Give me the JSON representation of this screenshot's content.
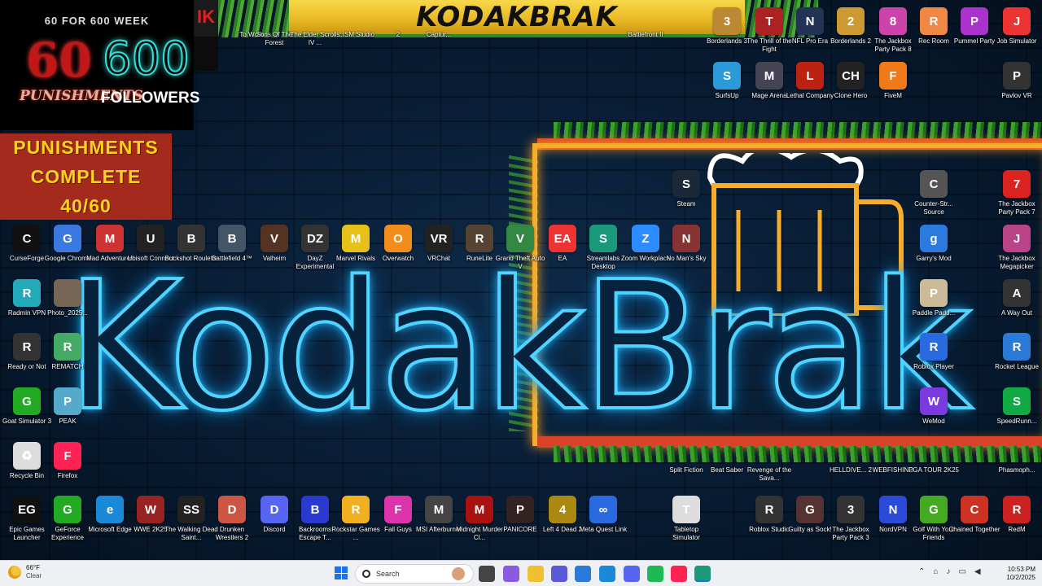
{
  "overlay": {
    "week_label": "60 FOR 600 WEEK",
    "num_a": "60",
    "num_b": "600",
    "label_a": "PUNISHMENTS",
    "label_b": "FOLLOWERS",
    "complete_line1": "PUNISHMENTS",
    "complete_line2": "COMPLETE",
    "complete_progress": "40/60",
    "strip_text": "IK"
  },
  "banner": {
    "title": "KODAKBRAK"
  },
  "wallpaper": {
    "neon_text": "KodakBrak"
  },
  "icons": [
    {
      "label": "To Work",
      "color": "#223",
      "glyph": ""
    },
    {
      "label": "Sons Of The Forest",
      "color": "#2a3a2a",
      "glyph": ""
    },
    {
      "label": "The Elder Scrolls IV ...",
      "color": "#3a3020",
      "glyph": ""
    },
    {
      "label": "...ISM Studio",
      "color": "#333",
      "glyph": ""
    },
    {
      "label": "2",
      "color": "#333",
      "glyph": ""
    },
    {
      "label": "Captur...",
      "color": "#333",
      "glyph": ""
    },
    {
      "label": "Battlefront II",
      "color": "#333",
      "glyph": ""
    },
    {
      "label": "Borderlands 3",
      "color": "#b83",
      "glyph": "3"
    },
    {
      "label": "The Thrill of the Fight",
      "color": "#a22",
      "glyph": "T"
    },
    {
      "label": "NFL Pro Era",
      "color": "#235",
      "glyph": "N"
    },
    {
      "label": "Borderlands 2",
      "color": "#c93",
      "glyph": "2"
    },
    {
      "label": "The Jackbox Party Pack 8",
      "color": "#c4a",
      "glyph": "8"
    },
    {
      "label": "Rec Room",
      "color": "#e84",
      "glyph": "R"
    },
    {
      "label": "Pummel Party",
      "color": "#a3c",
      "glyph": "P"
    },
    {
      "label": "Job Simulator",
      "color": "#e33",
      "glyph": "J"
    },
    {
      "label": "SurfsUp",
      "color": "#2a9ad8",
      "glyph": "S"
    },
    {
      "label": "Mage Arena",
      "color": "#445",
      "glyph": "M"
    },
    {
      "label": "Lethal Company",
      "color": "#b21",
      "glyph": "L"
    },
    {
      "label": "Clone Hero",
      "color": "#222",
      "glyph": "CH"
    },
    {
      "label": "FiveM",
      "color": "#f07a1a",
      "glyph": "F"
    },
    {
      "label": "Pavlov VR",
      "color": "#333",
      "glyph": "P"
    },
    {
      "label": "Steam",
      "color": "#1b2838",
      "glyph": "S"
    },
    {
      "label": "Counter-Str... Source",
      "color": "#555",
      "glyph": "C"
    },
    {
      "label": "The Jackbox Party Pack 7",
      "color": "#d22",
      "glyph": "7"
    },
    {
      "label": "CurseForge",
      "color": "#111",
      "glyph": "C"
    },
    {
      "label": "Google Chrome",
      "color": "#3a7ae0",
      "glyph": "G"
    },
    {
      "label": "Mad Adventures",
      "color": "#c33",
      "glyph": "M"
    },
    {
      "label": "Ubisoft Connect",
      "color": "#222",
      "glyph": "U"
    },
    {
      "label": "Buckshot Roulette",
      "color": "#333",
      "glyph": "B"
    },
    {
      "label": "Battlefield 4™",
      "color": "#456",
      "glyph": "B"
    },
    {
      "label": "Valheim",
      "color": "#532",
      "glyph": "V"
    },
    {
      "label": "DayZ Experimental",
      "color": "#333",
      "glyph": "DZ"
    },
    {
      "label": "Marvel Rivals",
      "color": "#e8c01a",
      "glyph": "M"
    },
    {
      "label": "Overwatch",
      "color": "#f28c1a",
      "glyph": "O"
    },
    {
      "label": "VRChat",
      "color": "#222",
      "glyph": "VR"
    },
    {
      "label": "RuneLite",
      "color": "#543",
      "glyph": "R"
    },
    {
      "label": "Grand Theft Auto V",
      "color": "#384",
      "glyph": "V"
    },
    {
      "label": "EA",
      "color": "#e33",
      "glyph": "EA"
    },
    {
      "label": "Streamlabs Desktop",
      "color": "#1a9a7a",
      "glyph": "S"
    },
    {
      "label": "Zoom Workplace",
      "color": "#2d8cff",
      "glyph": "Z"
    },
    {
      "label": "No Man's Sky",
      "color": "#833",
      "glyph": "N"
    },
    {
      "label": "Garry's Mod",
      "color": "#2a7ae0",
      "glyph": "g"
    },
    {
      "label": "The Jackbox Megapicker",
      "color": "#b48",
      "glyph": "J"
    },
    {
      "label": "Radmin VPN",
      "color": "#2ab",
      "glyph": "R"
    },
    {
      "label": "Photo_2025...",
      "color": "#765",
      "glyph": ""
    },
    {
      "label": "Paddle Padd...",
      "color": "#cb9",
      "glyph": "P"
    },
    {
      "label": "A Way Out",
      "color": "#333",
      "glyph": "A"
    },
    {
      "label": "Ready or Not",
      "color": "#333",
      "glyph": "R"
    },
    {
      "label": "REMATCH",
      "color": "#4a6",
      "glyph": "R"
    },
    {
      "label": "Roblox Player",
      "color": "#2a6ae0",
      "glyph": "R"
    },
    {
      "label": "Rocket League",
      "color": "#2a7ad8",
      "glyph": "R"
    },
    {
      "label": "Goat Simulator 3",
      "color": "#2a2",
      "glyph": "G"
    },
    {
      "label": "PEAK",
      "color": "#5ac",
      "glyph": "P"
    },
    {
      "label": "WeMod",
      "color": "#7a3ae0",
      "glyph": "W"
    },
    {
      "label": "SpeedRunn...",
      "color": "#1a4",
      "glyph": "S"
    },
    {
      "label": "Recycle Bin",
      "color": "#ddd",
      "glyph": "♻"
    },
    {
      "label": "Firefox",
      "color": "#f25",
      "glyph": "F"
    },
    {
      "label": "Split Fiction",
      "color": "#333",
      "glyph": ""
    },
    {
      "label": "Beat Saber",
      "color": "#333",
      "glyph": ""
    },
    {
      "label": "Revenge of the Sava...",
      "color": "#333",
      "glyph": ""
    },
    {
      "label": "HELLDIVE... 2",
      "color": "#333",
      "glyph": ""
    },
    {
      "label": "WEBFISHING",
      "color": "#333",
      "glyph": ""
    },
    {
      "label": "PGA TOUR 2K25",
      "color": "#333",
      "glyph": ""
    },
    {
      "label": "Phasmoph...",
      "color": "#333",
      "glyph": ""
    },
    {
      "label": "Epic Games Launcher",
      "color": "#111",
      "glyph": "EG"
    },
    {
      "label": "GeForce Experience",
      "color": "#2a2",
      "glyph": "G"
    },
    {
      "label": "Microsoft Edge",
      "color": "#1a8ad8",
      "glyph": "e"
    },
    {
      "label": "WWE 2K25",
      "color": "#922",
      "glyph": "W"
    },
    {
      "label": "The Walking Dead Saint...",
      "color": "#222",
      "glyph": "SS"
    },
    {
      "label": "Drunken Wrestlers 2",
      "color": "#c54",
      "glyph": "D"
    },
    {
      "label": "Discord",
      "color": "#5865f2",
      "glyph": "D"
    },
    {
      "label": "Backrooms Escape T...",
      "color": "#2a3ad0",
      "glyph": "B"
    },
    {
      "label": "Rockstar Games ...",
      "color": "#f0b020",
      "glyph": "R"
    },
    {
      "label": "Fall Guys",
      "color": "#d3a",
      "glyph": "F"
    },
    {
      "label": "MSI Afterburner",
      "color": "#444",
      "glyph": "M"
    },
    {
      "label": "Midnight Murder Cl...",
      "color": "#a11",
      "glyph": "M"
    },
    {
      "label": "PANICORE",
      "color": "#322",
      "glyph": "P"
    },
    {
      "label": "Left 4 Dead 2",
      "color": "#a81",
      "glyph": "4"
    },
    {
      "label": "Meta Quest Link",
      "color": "#2a6ae0",
      "glyph": "∞"
    },
    {
      "label": "Tabletop Simulator",
      "color": "#ddd",
      "glyph": "T"
    },
    {
      "label": "Roblox Studio",
      "color": "#333",
      "glyph": "R"
    },
    {
      "label": "Guilty as Sock!",
      "color": "#533",
      "glyph": "G"
    },
    {
      "label": "The Jackbox Party Pack 3",
      "color": "#333",
      "glyph": "3"
    },
    {
      "label": "NordVPN",
      "color": "#2a4ad8",
      "glyph": "N"
    },
    {
      "label": "Golf With Your Friends",
      "color": "#4a2",
      "glyph": "G"
    },
    {
      "label": "Chained Together",
      "color": "#c32",
      "glyph": "C"
    },
    {
      "label": "RedM",
      "color": "#c22",
      "glyph": "R"
    }
  ],
  "taskbar": {
    "temperature": "66°F",
    "condition": "Clear",
    "search_placeholder": "Search",
    "pinned": [
      {
        "name": "task-view",
        "color": "#444"
      },
      {
        "name": "copilot",
        "color": "#8a5ae0"
      },
      {
        "name": "file-explorer",
        "color": "#f0c030"
      },
      {
        "name": "teams",
        "color": "#5a5ad8"
      },
      {
        "name": "store",
        "color": "#2a7ad8"
      },
      {
        "name": "edge",
        "color": "#1a8ad8"
      },
      {
        "name": "discord",
        "color": "#5865f2"
      },
      {
        "name": "spotify",
        "color": "#1db954"
      },
      {
        "name": "firefox",
        "color": "#f25"
      },
      {
        "name": "streamlabs",
        "color": "#1a9a7a"
      }
    ],
    "time": "10:53 PM",
    "date": "10/2/2025"
  }
}
